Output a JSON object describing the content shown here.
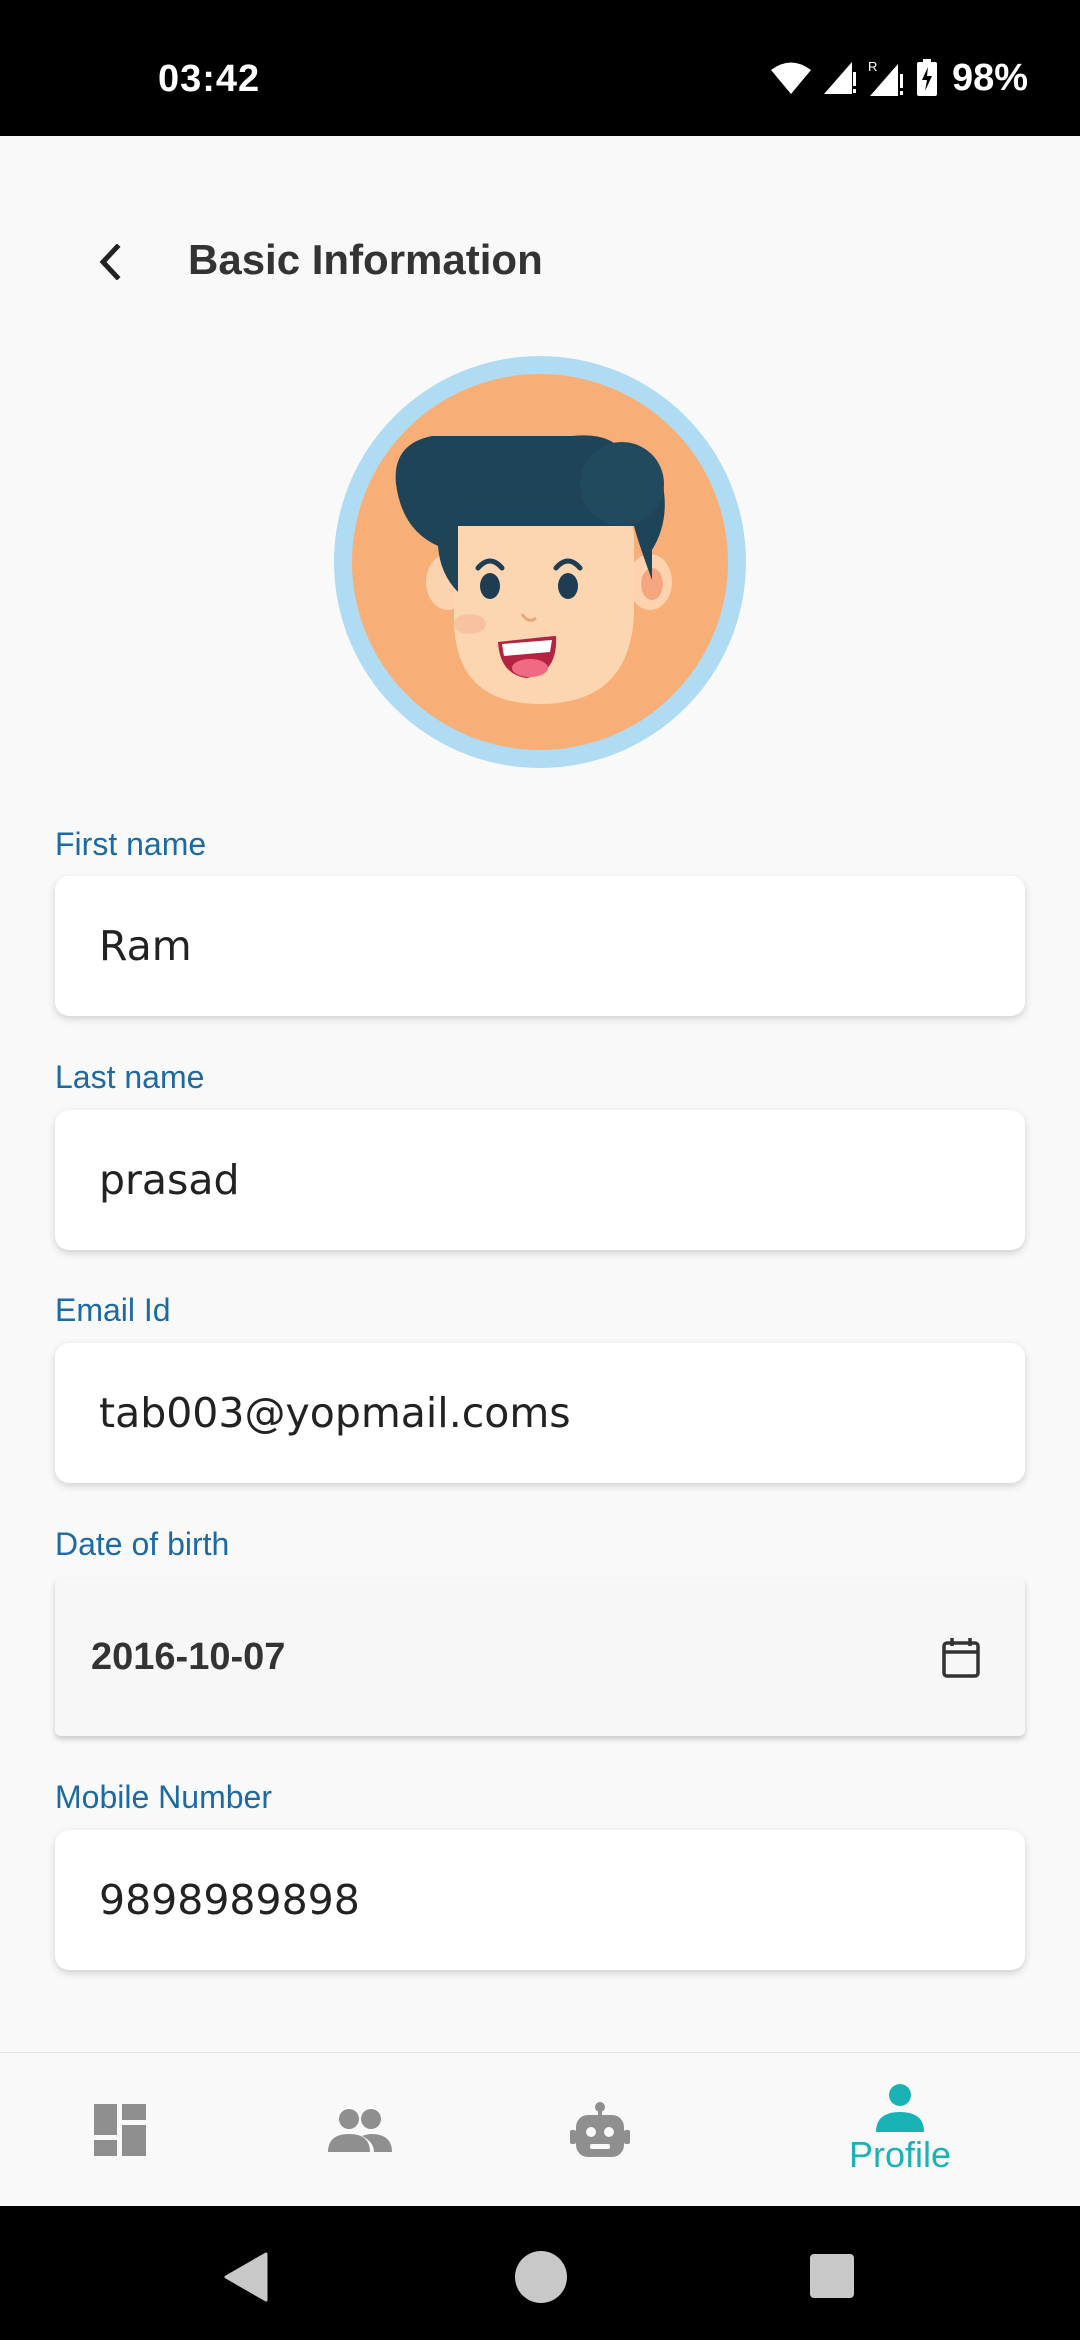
{
  "status_bar": {
    "time": "03:42",
    "battery": "98%",
    "icons": [
      "wifi-icon",
      "signal-icon",
      "signal-roaming-icon",
      "battery-charging-icon"
    ]
  },
  "header": {
    "title": "Basic Information",
    "back_icon": "chevron-left-icon"
  },
  "avatar": {
    "icon": "boy-cartoon-avatar"
  },
  "form": {
    "first_name": {
      "label": "First name",
      "value": "Ram"
    },
    "last_name": {
      "label": "Last name",
      "value": "prasad"
    },
    "email": {
      "label": "Email Id",
      "value": "tab003@yopmail.coms"
    },
    "dob": {
      "label": "Date of birth",
      "value": "2016-10-07",
      "icon": "calendar-icon"
    },
    "mobile": {
      "label": "Mobile Number",
      "value": "9898989898"
    }
  },
  "bottom_nav": {
    "items": [
      {
        "icon": "dashboard-icon",
        "label": ""
      },
      {
        "icon": "people-icon",
        "label": ""
      },
      {
        "icon": "robot-icon",
        "label": ""
      },
      {
        "icon": "person-icon",
        "label": "Profile",
        "active": true
      }
    ],
    "active_color": "#19b3b6",
    "inactive_color": "#8f8f8f"
  },
  "system_nav": [
    "back-triangle-icon",
    "home-circle-icon",
    "recents-square-icon"
  ],
  "colors": {
    "label": "#1c6aa3",
    "avatar_ring": "#afdcf2",
    "avatar_bg": "#f8af77"
  }
}
